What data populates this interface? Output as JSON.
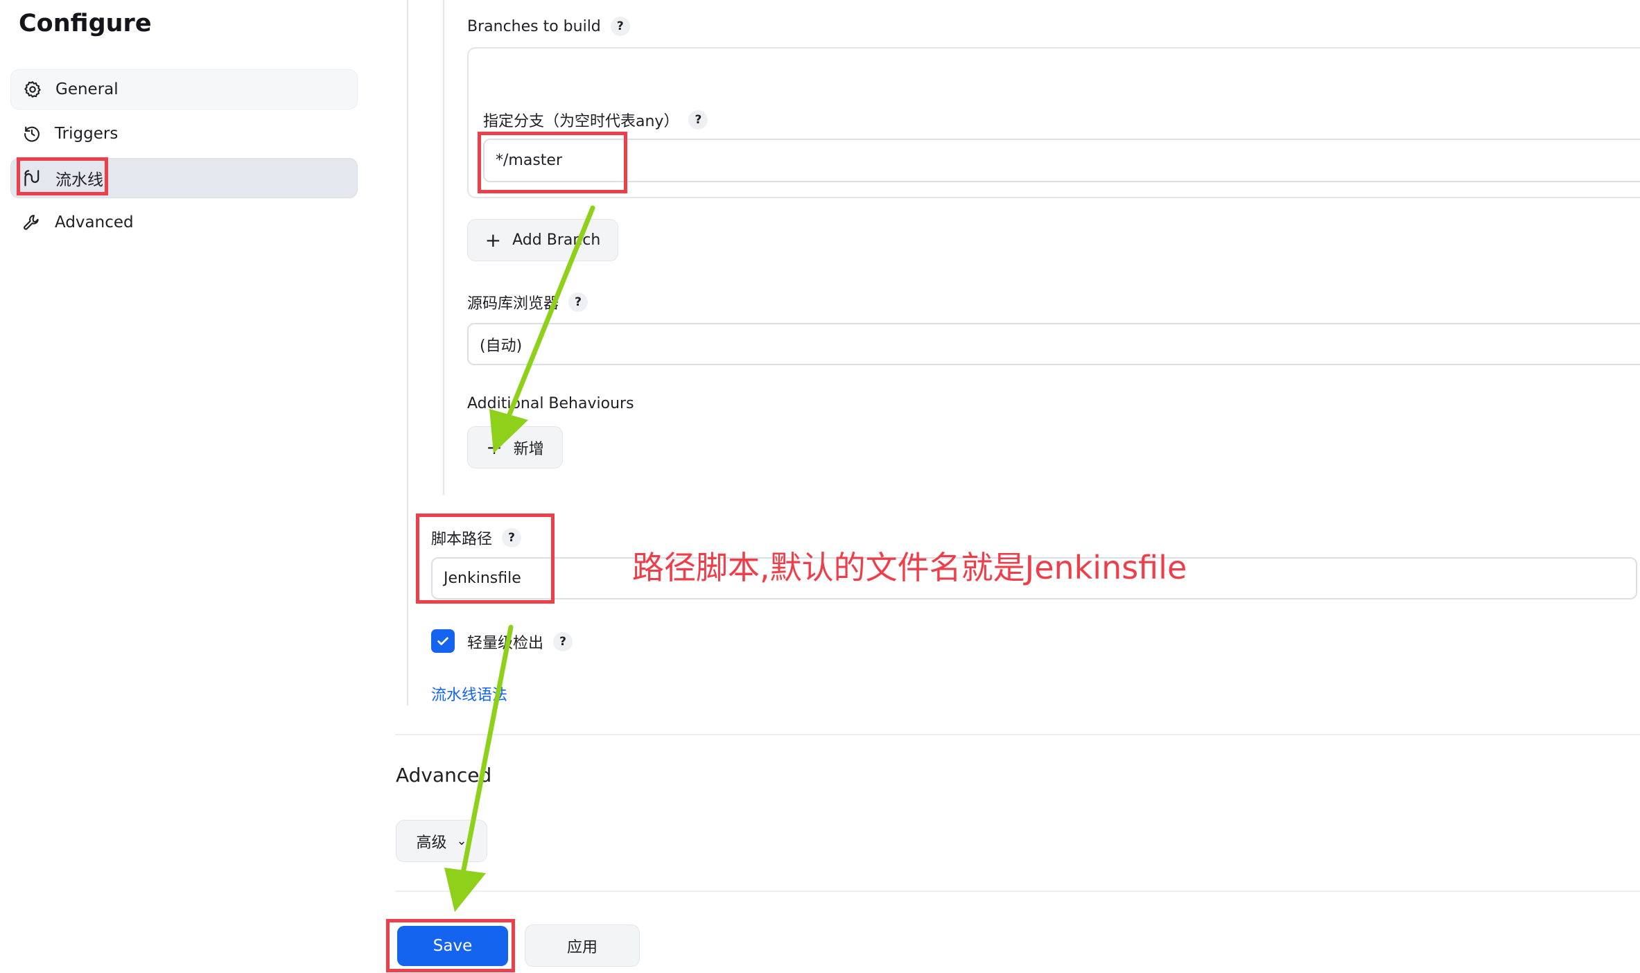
{
  "sidebar": {
    "title": "Configure",
    "items": [
      {
        "label": "General",
        "icon": "gear-icon"
      },
      {
        "label": "Triggers",
        "icon": "clock-icon"
      },
      {
        "label": "流水线",
        "icon": "pipeline-icon",
        "selected": true
      },
      {
        "label": "Advanced",
        "icon": "wrench-icon"
      }
    ]
  },
  "scm": {
    "branches_label": "Branches to build",
    "branch_specifier_label": "指定分支（为空时代表any）",
    "branch_specifier_value": "*/master",
    "add_branch_label": "Add Branch",
    "repo_browser_label": "源码库浏览器",
    "repo_browser_value": "(自动)",
    "additional_behaviours_label": "Additional Behaviours",
    "add_behaviour_label": "新增"
  },
  "pipeline": {
    "script_path_label": "脚本路径",
    "script_path_value": "Jenkinsfile",
    "lightweight_checkout_label": "轻量级检出",
    "lightweight_checkout_checked": true,
    "syntax_link": "流水线语法"
  },
  "advanced": {
    "heading": "Advanced",
    "toggle_label": "高级"
  },
  "footer": {
    "save_label": "Save",
    "apply_label": "应用"
  },
  "help_glyph": "?",
  "annotation": {
    "text": "路径脚本,默认的文件名就是Jenkinsfile",
    "color": "#ee3e4a"
  },
  "colors": {
    "accent": "#1464f0",
    "highlight_box": "#ee3e4a",
    "arrow": "#8fd11a",
    "link": "#1464f0"
  }
}
